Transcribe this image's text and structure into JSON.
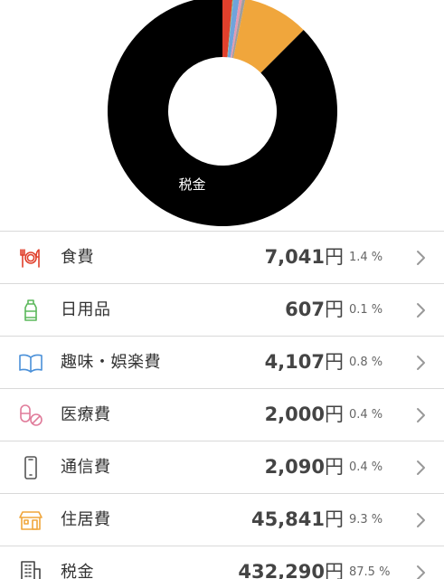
{
  "chart_data": {
    "type": "pie",
    "title": "",
    "donut": true,
    "categories": [
      "食費",
      "日用品",
      "趣味・娯楽費",
      "医療費",
      "通信費",
      "住居費",
      "税金"
    ],
    "values": [
      7041,
      607,
      4107,
      2000,
      2090,
      45841,
      432290
    ],
    "colors": [
      "#e0402c",
      "#7cc18f",
      "#6fa3dc",
      "#e69ab0",
      "#9e9e9e",
      "#f0a63c",
      "#000000"
    ],
    "slice_labels": [
      "",
      "",
      "",
      "",
      "",
      "",
      "税金"
    ]
  },
  "list": {
    "yen": "円",
    "items": [
      {
        "icon": "fork-knife-plate-icon",
        "label": "食費",
        "amount": "7,041",
        "percent": "1.4 %",
        "color": "#e0402c"
      },
      {
        "icon": "detergent-bottle-icon",
        "label": "日用品",
        "amount": "607",
        "percent": "0.1 %",
        "color": "#5cb85c"
      },
      {
        "icon": "open-book-icon",
        "label": "趣味・娯楽費",
        "amount": "4,107",
        "percent": "0.8 %",
        "color": "#4a90d9"
      },
      {
        "icon": "pills-icon",
        "label": "医療費",
        "amount": "2,000",
        "percent": "0.4 %",
        "color": "#e07b9a"
      },
      {
        "icon": "smartphone-icon",
        "label": "通信費",
        "amount": "2,090",
        "percent": "0.4 %",
        "color": "#555555"
      },
      {
        "icon": "house-icon",
        "label": "住居費",
        "amount": "45,841",
        "percent": "9.3 %",
        "color": "#f0a63c"
      },
      {
        "icon": "building-icon",
        "label": "税金",
        "amount": "432,290",
        "percent": "87.5 %",
        "color": "#444444"
      }
    ]
  }
}
